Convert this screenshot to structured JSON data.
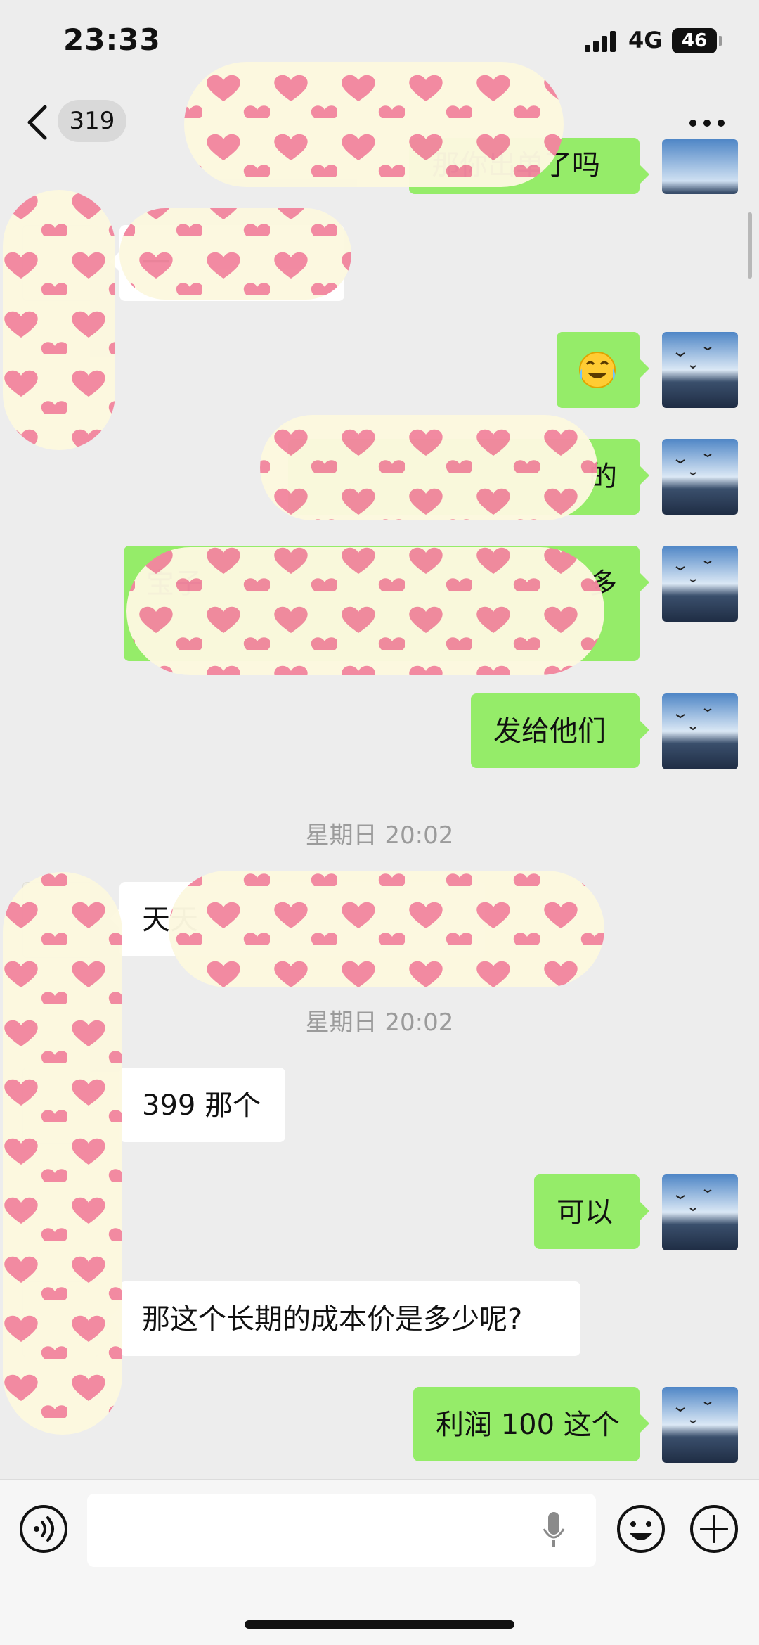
{
  "status_bar": {
    "time": "23:33",
    "network": "4G",
    "battery": "46"
  },
  "nav": {
    "unread_count": "319"
  },
  "messages": {
    "m0": "那你出单了吗",
    "m1": "一",
    "m3": "的",
    "m4": "宝子",
    "m4b": "多",
    "m5": "发给他们",
    "t1": "星期日 20:02",
    "m6": "天天",
    "t2": "星期日 20:02",
    "m7": "399 那个",
    "m8": "可以",
    "m9": "那这个长期的成本价是多少呢?",
    "m10": "利润 100 这个"
  },
  "colors": {
    "sent_bubble": "#95ec69",
    "received_bubble": "#ffffff",
    "background": "#ededed"
  },
  "icons": [
    "back-icon",
    "more-icon",
    "emoji-sticker-icon",
    "voice-icon",
    "mic-icon",
    "emoji-icon",
    "plus-icon"
  ]
}
